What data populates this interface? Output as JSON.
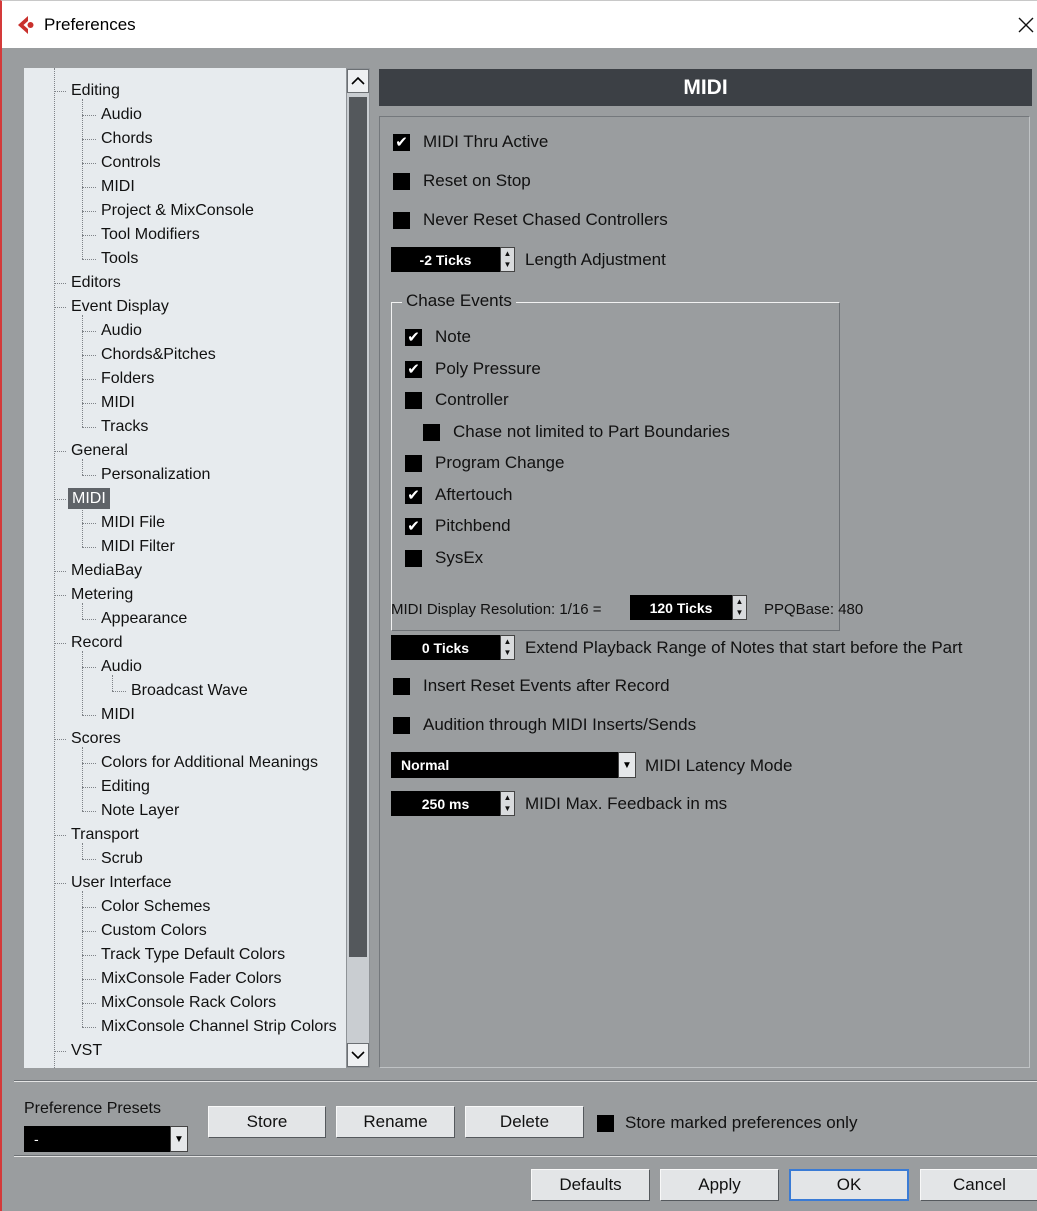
{
  "window": {
    "title": "Preferences",
    "accent_color": "#d43a3a"
  },
  "tree": {
    "items": [
      {
        "label": "Editing",
        "level": 0,
        "selected": false
      },
      {
        "label": "Audio",
        "level": 1,
        "selected": false
      },
      {
        "label": "Chords",
        "level": 1,
        "selected": false
      },
      {
        "label": "Controls",
        "level": 1,
        "selected": false
      },
      {
        "label": "MIDI",
        "level": 1,
        "selected": false
      },
      {
        "label": "Project & MixConsole",
        "level": 1,
        "selected": false
      },
      {
        "label": "Tool Modifiers",
        "level": 1,
        "selected": false
      },
      {
        "label": "Tools",
        "level": 1,
        "selected": false
      },
      {
        "label": "Editors",
        "level": 0,
        "selected": false
      },
      {
        "label": "Event Display",
        "level": 0,
        "selected": false
      },
      {
        "label": "Audio",
        "level": 1,
        "selected": false
      },
      {
        "label": "Chords&Pitches",
        "level": 1,
        "selected": false
      },
      {
        "label": "Folders",
        "level": 1,
        "selected": false
      },
      {
        "label": "MIDI",
        "level": 1,
        "selected": false
      },
      {
        "label": "Tracks",
        "level": 1,
        "selected": false
      },
      {
        "label": "General",
        "level": 0,
        "selected": false
      },
      {
        "label": "Personalization",
        "level": 1,
        "selected": false
      },
      {
        "label": "MIDI",
        "level": 0,
        "selected": true
      },
      {
        "label": "MIDI File",
        "level": 1,
        "selected": false
      },
      {
        "label": "MIDI Filter",
        "level": 1,
        "selected": false
      },
      {
        "label": "MediaBay",
        "level": 0,
        "selected": false
      },
      {
        "label": "Metering",
        "level": 0,
        "selected": false
      },
      {
        "label": "Appearance",
        "level": 1,
        "selected": false
      },
      {
        "label": "Record",
        "level": 0,
        "selected": false
      },
      {
        "label": "Audio",
        "level": 1,
        "selected": false
      },
      {
        "label": "Broadcast Wave",
        "level": 2,
        "selected": false
      },
      {
        "label": "MIDI",
        "level": 1,
        "selected": false
      },
      {
        "label": "Scores",
        "level": 0,
        "selected": false
      },
      {
        "label": "Colors for Additional Meanings",
        "level": 1,
        "selected": false
      },
      {
        "label": "Editing",
        "level": 1,
        "selected": false
      },
      {
        "label": "Note Layer",
        "level": 1,
        "selected": false
      },
      {
        "label": "Transport",
        "level": 0,
        "selected": false
      },
      {
        "label": "Scrub",
        "level": 1,
        "selected": false
      },
      {
        "label": "User Interface",
        "level": 0,
        "selected": false
      },
      {
        "label": "Color Schemes",
        "level": 1,
        "selected": false
      },
      {
        "label": "Custom Colors",
        "level": 1,
        "selected": false
      },
      {
        "label": "Track Type Default Colors",
        "level": 1,
        "selected": false
      },
      {
        "label": "MixConsole Fader Colors",
        "level": 1,
        "selected": false
      },
      {
        "label": "MixConsole Rack Colors",
        "level": 1,
        "selected": false
      },
      {
        "label": "MixConsole Channel Strip Colors",
        "level": 1,
        "selected": false
      },
      {
        "label": "VST",
        "level": 0,
        "selected": false
      }
    ]
  },
  "panel": {
    "title": "MIDI",
    "midi_thru_active": {
      "label": "MIDI Thru Active",
      "checked": true
    },
    "reset_on_stop": {
      "label": "Reset on Stop",
      "checked": false
    },
    "never_reset_chased": {
      "label": "Never Reset Chased Controllers",
      "checked": false
    },
    "length_adjustment": {
      "value": "-2 Ticks",
      "label": "Length Adjustment"
    },
    "chase_events": {
      "title": "Chase Events",
      "items": [
        {
          "label": "Note",
          "checked": true,
          "indent": false
        },
        {
          "label": "Poly Pressure",
          "checked": true,
          "indent": false
        },
        {
          "label": "Controller",
          "checked": false,
          "indent": false
        },
        {
          "label": "Chase not limited to Part Boundaries",
          "checked": false,
          "indent": true
        },
        {
          "label": "Program Change",
          "checked": false,
          "indent": false
        },
        {
          "label": "Aftertouch",
          "checked": true,
          "indent": false
        },
        {
          "label": "Pitchbend",
          "checked": true,
          "indent": false
        },
        {
          "label": "SysEx",
          "checked": false,
          "indent": false
        }
      ]
    },
    "display_resolution": {
      "label": "MIDI Display Resolution: 1/16 =",
      "value": "120 Ticks",
      "ppq_label": "PPQBase: 480"
    },
    "extend_playback": {
      "value": "0 Ticks",
      "label": "Extend Playback Range of Notes that start before the Part"
    },
    "insert_reset": {
      "label": "Insert Reset Events after Record",
      "checked": false
    },
    "audition": {
      "label": "Audition through MIDI Inserts/Sends",
      "checked": false
    },
    "latency_mode": {
      "value": "Normal",
      "label": "MIDI Latency Mode"
    },
    "max_feedback": {
      "value": "250 ms",
      "label": "MIDI Max. Feedback in ms"
    }
  },
  "presets": {
    "label": "Preference Presets",
    "selected": "-",
    "store_label": "Store",
    "rename_label": "Rename",
    "delete_label": "Delete",
    "store_marked": {
      "label": "Store marked preferences only",
      "checked": false
    }
  },
  "footer": {
    "defaults_label": "Defaults",
    "apply_label": "Apply",
    "ok_label": "OK",
    "cancel_label": "Cancel"
  }
}
